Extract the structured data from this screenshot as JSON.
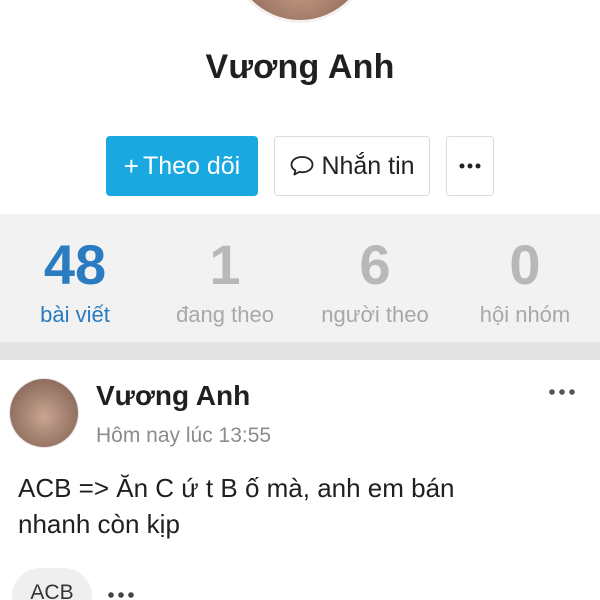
{
  "profile": {
    "name": "Vương Anh"
  },
  "actions": {
    "follow_plus": "+",
    "follow_label": "Theo dõi",
    "message_label": "Nhắn tin"
  },
  "stats": [
    {
      "count": "48",
      "label": "bài viết",
      "active": true
    },
    {
      "count": "1",
      "label": "đang theo",
      "active": false
    },
    {
      "count": "6",
      "label": "người theo",
      "active": false
    },
    {
      "count": "0",
      "label": "hội nhóm",
      "active": false
    }
  ],
  "post": {
    "author": "Vương Anh",
    "time": "Hôm nay lúc 13:55",
    "text_line1": "ACB => Ăn C ứ t B ố mà, anh em bán",
    "text_line2": "nhanh còn kịp",
    "tag": "ACB"
  },
  "colors": {
    "accent_blue": "#1aa8e0",
    "active_stat": "#2a7bbf",
    "inactive_stat": "#b8b8b8"
  },
  "icons": {
    "message": "chat-bubble-icon",
    "more": "ellipsis-icon"
  }
}
